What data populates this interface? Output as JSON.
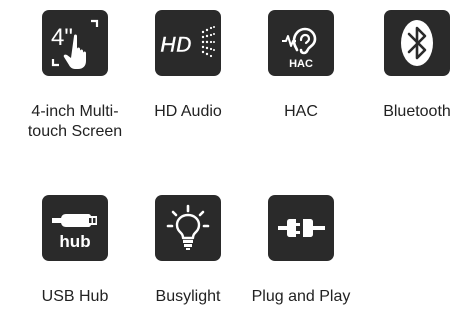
{
  "features": [
    {
      "id": "touchscreen",
      "icon": "touchscreen-icon",
      "tile_text": "4\"",
      "label": "4-inch Multi-touch Screen"
    },
    {
      "id": "hd-audio",
      "icon": "hd-audio-icon",
      "tile_text": "HD",
      "label": "HD Audio"
    },
    {
      "id": "hac",
      "icon": "hearing-aid-icon",
      "tile_text": "HAC",
      "label": "HAC"
    },
    {
      "id": "bluetooth",
      "icon": "bluetooth-icon",
      "label": "Bluetooth"
    },
    {
      "id": "usb-hub",
      "icon": "usb-hub-icon",
      "tile_text": "hub",
      "label": "USB Hub"
    },
    {
      "id": "busylight",
      "icon": "busylight-icon",
      "label": "Busylight"
    },
    {
      "id": "plug-and-play",
      "icon": "plug-and-play-icon",
      "label": "Plug and Play"
    }
  ],
  "colors": {
    "tile_background": "#2a2a2a",
    "icon_foreground": "#ffffff",
    "label_text": "#222222"
  }
}
